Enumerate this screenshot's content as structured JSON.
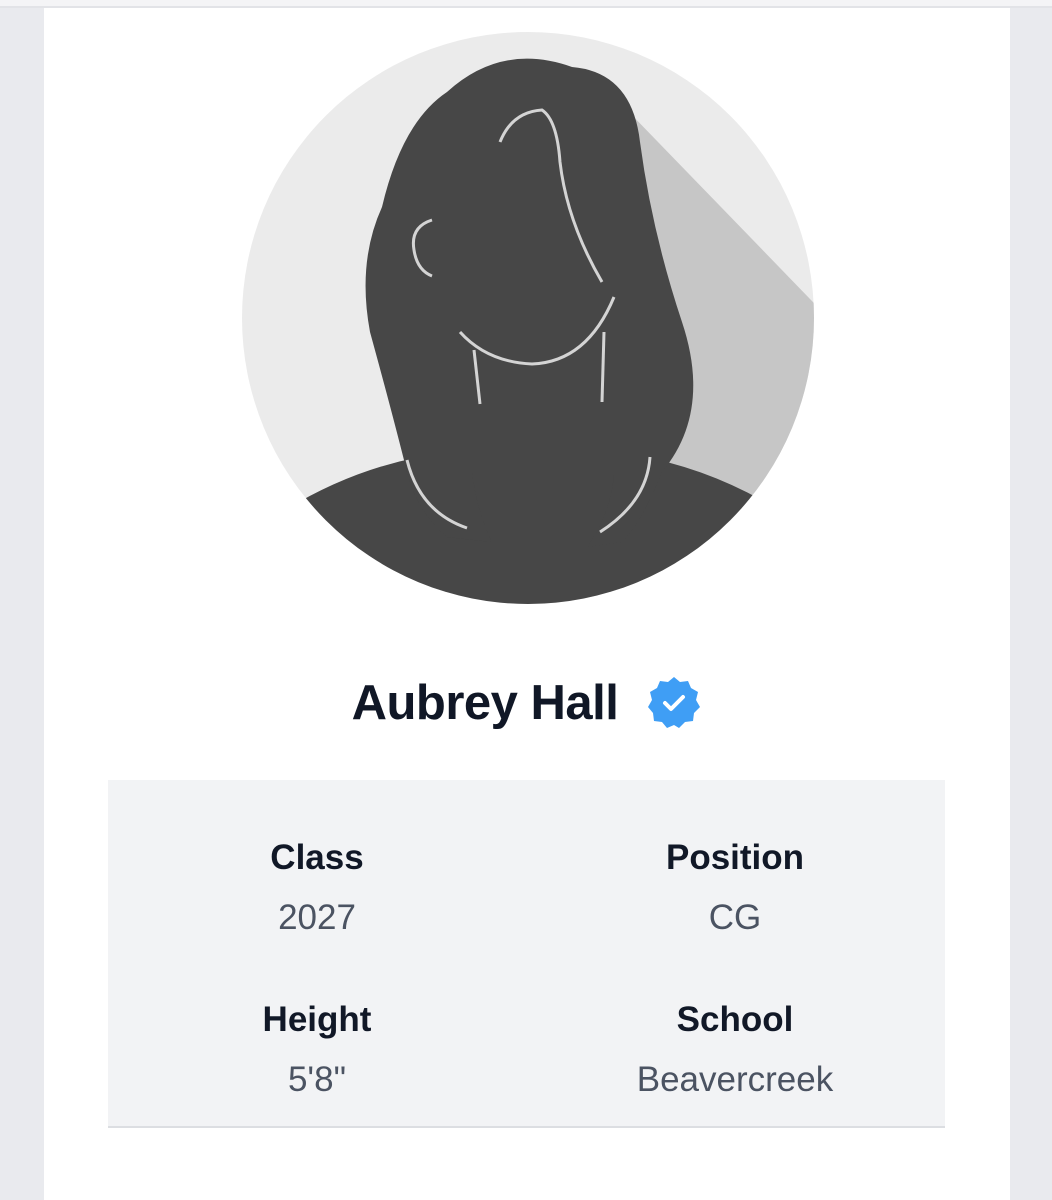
{
  "profile": {
    "name": "Aubrey Hall",
    "verified": true,
    "avatar": {
      "icon": "female-silhouette-avatar-icon",
      "background_color": "#ebebeb",
      "silhouette_color": "#474747",
      "shadow_color": "#c6c6c6"
    },
    "badge": {
      "icon": "verified-check-icon",
      "color": "#3f9ef5"
    }
  },
  "details": {
    "class": {
      "label": "Class",
      "value": "2027"
    },
    "position": {
      "label": "Position",
      "value": "CG"
    },
    "height": {
      "label": "Height",
      "value": "5'8\""
    },
    "school": {
      "label": "School",
      "value": "Beavercreek"
    }
  }
}
